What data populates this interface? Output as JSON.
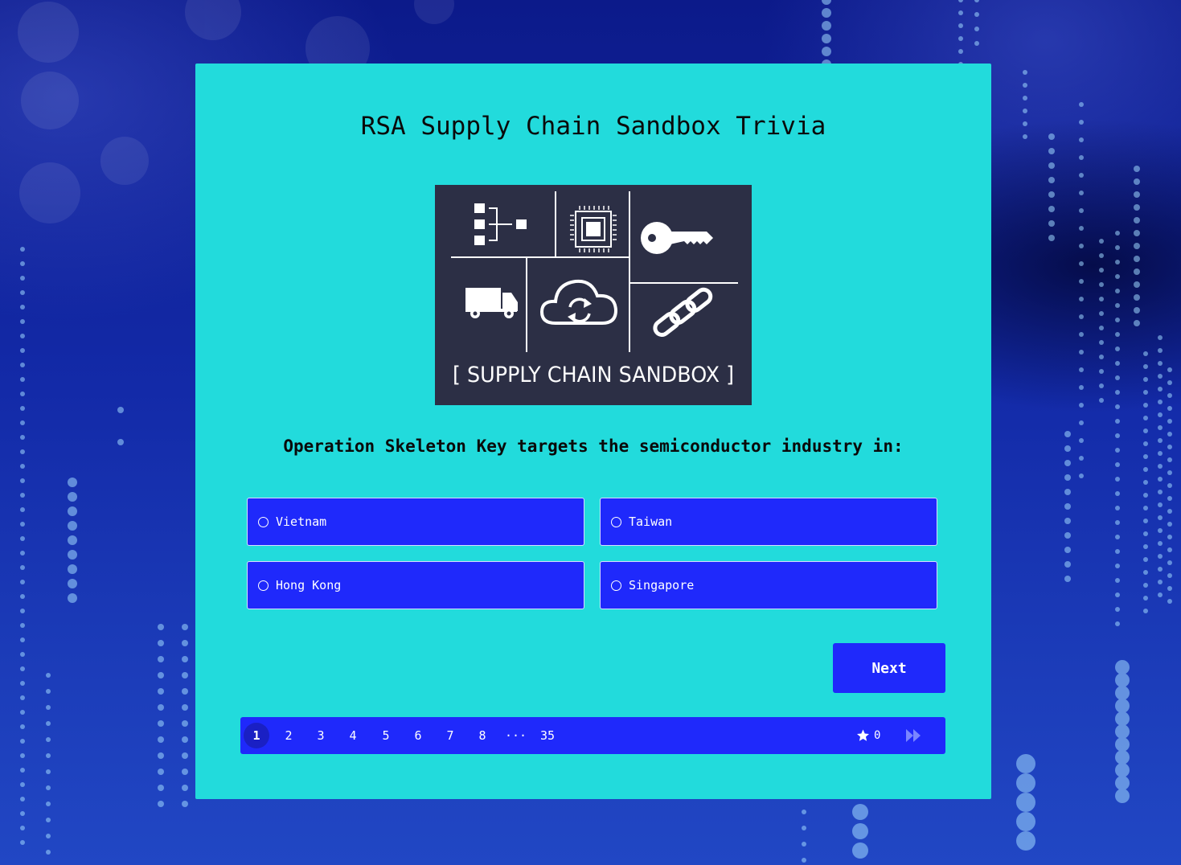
{
  "quiz": {
    "title": "RSA Supply Chain Sandbox Trivia",
    "logo_text": "[ SUPPLY CHAIN SANDBOX ]",
    "logo_icons": [
      "org-chart-icon",
      "chip-icon",
      "key-icon",
      "truck-icon",
      "cloud-sync-icon",
      "chain-link-icon"
    ],
    "question": "Operation Skeleton Key targets the semiconductor industry in:",
    "options": [
      {
        "label": "Vietnam",
        "selected": false
      },
      {
        "label": "Taiwan",
        "selected": false
      },
      {
        "label": "Hong Kong",
        "selected": false
      },
      {
        "label": "Singapore",
        "selected": false
      }
    ],
    "next_label": "Next"
  },
  "pagination": {
    "pages": [
      "1",
      "2",
      "3",
      "4",
      "5",
      "6",
      "7",
      "8"
    ],
    "ellipsis": "···",
    "last_page": "35",
    "current_page": "1",
    "score": "0",
    "score_icon": "star-icon",
    "skip_icon": "fast-forward-icon"
  },
  "colors": {
    "background": "#132aa8",
    "card": "#22dbdc",
    "accent": "#1f29fb",
    "logo_background": "#2c2f45"
  }
}
